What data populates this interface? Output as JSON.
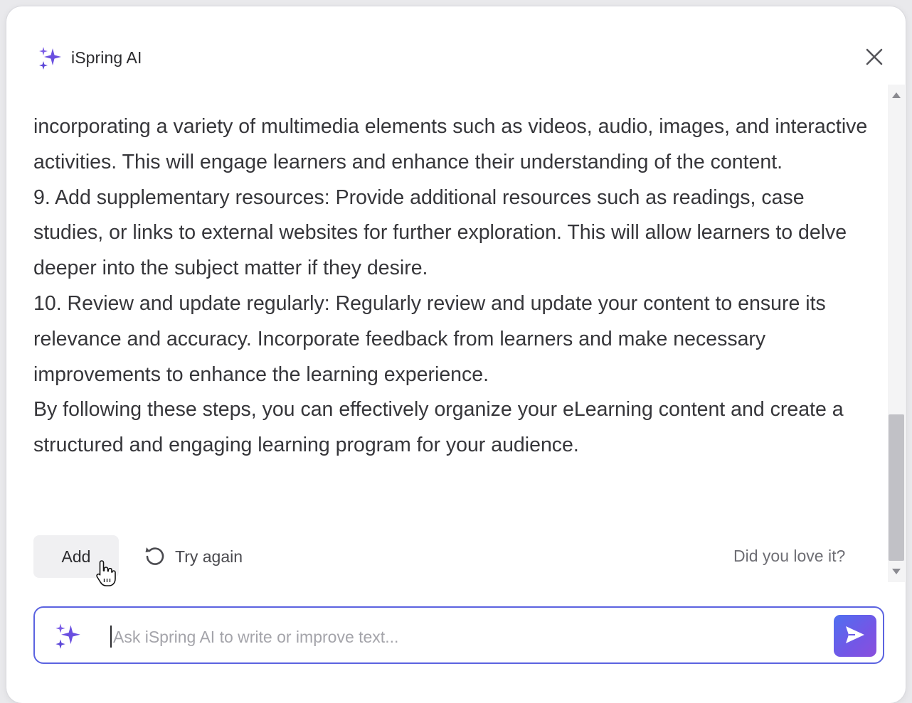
{
  "header": {
    "title": "iSpring AI",
    "logo_icon": "sparkles-icon",
    "close_icon": "close-icon"
  },
  "content": {
    "paragraphs": [
      "incorporating a variety of multimedia elements such as videos, audio, images, and interactive activities. This will engage learners and enhance their understanding of the content.",
      "9. Add supplementary resources: Provide additional resources such as readings, case studies, or links to external websites for further exploration. This will allow learners to delve deeper into the subject matter if they desire.",
      "10. Review and update regularly: Regularly review and update your content to ensure its relevance and accuracy. Incorporate feedback from learners and make necessary improvements to enhance the learning experience.",
      "By following these steps, you can effectively organize your eLearning content and create a structured and engaging learning program for your audience."
    ]
  },
  "actions": {
    "add_label": "Add",
    "try_again_label": "Try again",
    "try_again_icon": "refresh-icon",
    "feedback_label": "Did you love it?"
  },
  "input": {
    "placeholder": "Ask iSpring AI to write or improve text...",
    "value": "",
    "spark_icon": "sparkles-icon",
    "send_icon": "send-icon"
  },
  "colors": {
    "accent": "#5b63e0",
    "spark_purple": "#6a4fe0",
    "send_gradient_start": "#4f6ff0",
    "send_gradient_end": "#8a4fdd"
  }
}
